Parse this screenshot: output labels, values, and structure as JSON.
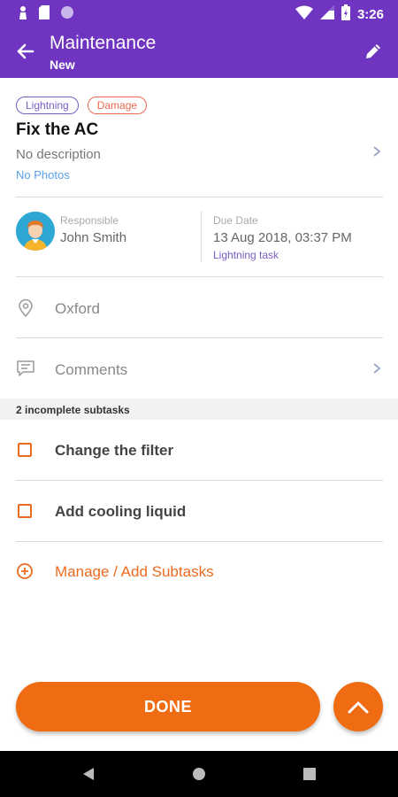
{
  "status_bar": {
    "time": "3:26",
    "icons": [
      "person-icon",
      "sd-card-icon",
      "circle-icon",
      "wifi-icon",
      "signal-icon",
      "battery-icon"
    ]
  },
  "app_bar": {
    "title": "Maintenance",
    "subtitle": "New",
    "back_icon": "arrow-back-icon",
    "edit_icon": "pencil-icon",
    "color": "#6f35c0"
  },
  "task": {
    "tags": [
      "Lightning",
      "Damage"
    ],
    "title": "Fix the AC",
    "description": "No description",
    "photos": "No Photos"
  },
  "assignment": {
    "responsible_label": "Responsible",
    "responsible_name": "John Smith",
    "due_label": "Due Date",
    "due_value": "13 Aug 2018, 03:37 PM",
    "due_type": "Lightning task"
  },
  "location": {
    "value": "Oxford",
    "icon": "location-pin-icon"
  },
  "comments": {
    "label": "Comments",
    "icon": "comment-icon"
  },
  "subtasks": {
    "header": "2 incomplete subtasks",
    "items": [
      "Change the filter",
      "Add cooling liquid"
    ],
    "manage_label": "Manage / Add Subtasks"
  },
  "actions": {
    "done_label": "DONE",
    "accent": "#ef6c12",
    "fab_icon": "chevron-up-icon"
  },
  "nav_bar": {
    "icons": [
      "nav-back-icon",
      "nav-home-icon",
      "nav-recents-icon"
    ]
  }
}
